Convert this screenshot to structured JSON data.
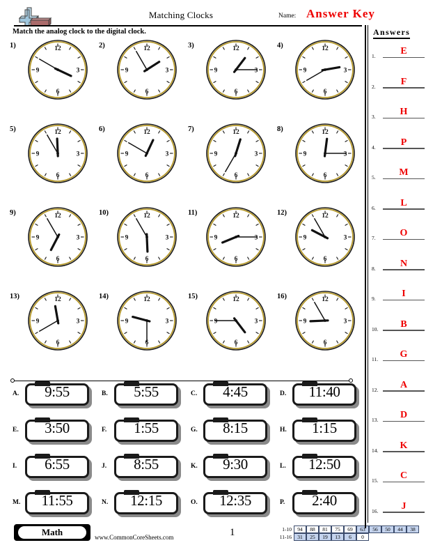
{
  "header": {
    "title": "Matching Clocks",
    "name_label": "Name:",
    "answer_key": "Answer Key",
    "instructions": "Match the analog clock to the digital clock.",
    "logo_icon": "plus-block-logo"
  },
  "answers_panel": {
    "title": "Answers",
    "rows": [
      {
        "num": "1.",
        "value": "E"
      },
      {
        "num": "2.",
        "value": "F"
      },
      {
        "num": "3.",
        "value": "H"
      },
      {
        "num": "4.",
        "value": "P"
      },
      {
        "num": "5.",
        "value": "M"
      },
      {
        "num": "6.",
        "value": "L"
      },
      {
        "num": "7.",
        "value": "O"
      },
      {
        "num": "8.",
        "value": "N"
      },
      {
        "num": "9.",
        "value": "I"
      },
      {
        "num": "10.",
        "value": "B"
      },
      {
        "num": "11.",
        "value": "G"
      },
      {
        "num": "12.",
        "value": "A"
      },
      {
        "num": "13.",
        "value": "D"
      },
      {
        "num": "14.",
        "value": "K"
      },
      {
        "num": "15.",
        "value": "C"
      },
      {
        "num": "16.",
        "value": "J"
      }
    ]
  },
  "clocks": [
    {
      "num": "1)",
      "hour": 3,
      "minute": 50
    },
    {
      "num": "2)",
      "hour": 1,
      "minute": 55
    },
    {
      "num": "3)",
      "hour": 1,
      "minute": 15
    },
    {
      "num": "4)",
      "hour": 2,
      "minute": 40
    },
    {
      "num": "5)",
      "hour": 11,
      "minute": 55
    },
    {
      "num": "6)",
      "hour": 12,
      "minute": 50
    },
    {
      "num": "7)",
      "hour": 12,
      "minute": 35
    },
    {
      "num": "8)",
      "hour": 12,
      "minute": 15
    },
    {
      "num": "9)",
      "hour": 6,
      "minute": 55
    },
    {
      "num": "10)",
      "hour": 5,
      "minute": 55
    },
    {
      "num": "11)",
      "hour": 8,
      "minute": 15
    },
    {
      "num": "12)",
      "hour": 9,
      "minute": 55
    },
    {
      "num": "13)",
      "hour": 11,
      "minute": 40
    },
    {
      "num": "14)",
      "hour": 9,
      "minute": 30
    },
    {
      "num": "15)",
      "hour": 4,
      "minute": 45
    },
    {
      "num": "16)",
      "hour": 8,
      "minute": 55
    }
  ],
  "clock_face": {
    "numerals": [
      "12",
      "3",
      "6",
      "9"
    ],
    "ring_color": "#b5982a",
    "outer_color": "#1a1a1a"
  },
  "answer_bank": [
    {
      "letter": "A.",
      "time": "9:55"
    },
    {
      "letter": "B.",
      "time": "5:55"
    },
    {
      "letter": "C.",
      "time": "4:45"
    },
    {
      "letter": "D.",
      "time": "11:40"
    },
    {
      "letter": "E.",
      "time": "3:50"
    },
    {
      "letter": "F.",
      "time": "1:55"
    },
    {
      "letter": "G.",
      "time": "8:15"
    },
    {
      "letter": "H.",
      "time": "1:15"
    },
    {
      "letter": "I.",
      "time": "6:55"
    },
    {
      "letter": "J.",
      "time": "8:55"
    },
    {
      "letter": "K.",
      "time": "9:30"
    },
    {
      "letter": "L.",
      "time": "12:50"
    },
    {
      "letter": "M.",
      "time": "11:55"
    },
    {
      "letter": "N.",
      "time": "12:15"
    },
    {
      "letter": "O.",
      "time": "12:35"
    },
    {
      "letter": "P.",
      "time": "2:40"
    }
  ],
  "footer": {
    "subject": "Math",
    "website": "www.CommonCoreSheets.com",
    "page_number": "1",
    "score_table": {
      "row1_label": "1-10",
      "row1_values": [
        "94",
        "88",
        "81",
        "75",
        "69",
        "63",
        "56",
        "50",
        "44",
        "38"
      ],
      "row1_highlight": [
        false,
        false,
        false,
        false,
        false,
        true,
        true,
        true,
        true,
        true
      ],
      "row2_label": "11-16",
      "row2_values": [
        "31",
        "25",
        "19",
        "13",
        "6",
        "0"
      ],
      "row2_highlight": [
        true,
        true,
        true,
        true,
        true,
        false
      ],
      "highlight_color": "#c5d4ee"
    }
  }
}
